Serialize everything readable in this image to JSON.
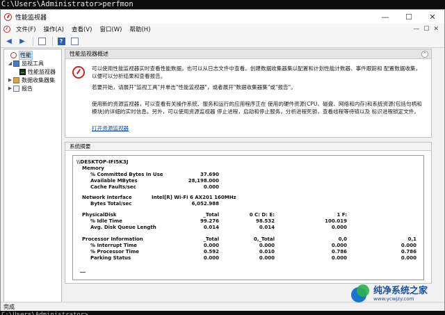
{
  "console": {
    "prompt_line": "C:\\Users\\Administrator>perfmon",
    "bottom_line": "C:\\Users\\Administrator>"
  },
  "window": {
    "title": "性能监视器",
    "controls": {
      "minimize": "—",
      "maximize": "☐",
      "close": "✕"
    }
  },
  "menubar": {
    "items": [
      "文件(F)",
      "操作(A)",
      "查看(V)",
      "窗口(W)",
      "帮助(H)"
    ],
    "right_controls": [
      "—",
      "☐",
      "✕"
    ]
  },
  "tree": {
    "root": "性能",
    "monitor_tools": "监视工具",
    "perf_monitor": "性能监视器",
    "collector_sets": "数据收集器集",
    "reports": "报告"
  },
  "overview": {
    "header": "性能监视器概述",
    "para1": "可以使用性能监视器实时查看性能数据，也可以从日志文件中查看。创建数据收集器集以配置和计划性能计数器、事件跟踪和 配置数据收集，以便可以分析结果和查看报告。",
    "para2": "若要开始，请展开\"监视工具\"并单击\"性能监视器\"，或者展开\"数据收集器集\"或\"报告\"。",
    "para3": "使用新的资源监视器，可以查看有关操作系统、服务和运行的应用程序正在 使用的硬件资源(CPU、磁盘、网络和内存)和系统资源(包括句柄和模块)的详细的实时信息。另外，可以使用资源监视器 停止进程，启动和停止服务，分析进程死锁，查看线程等待链以及 标识进程锁定文件。",
    "link": "打开资源监视器"
  },
  "summary": {
    "header": "系统摘要",
    "host": "\\\\DESKTOP-IFI5K3J",
    "memory": {
      "label": "Memory",
      "committed_label": "% Committed Bytes In Use",
      "committed": "37.690",
      "available_label": "Available MBytes",
      "available": "28,198.000",
      "cache_label": "Cache Faults/sec",
      "cache": "0.000"
    },
    "network": {
      "label": "Network Interface",
      "adapter": "Intel[R] Wi-Fi 6 AX201 160MHz",
      "bytes_label": "Bytes Total/sec",
      "bytes": "6,052.988"
    },
    "disk": {
      "label": "PhysicalDisk",
      "cols": [
        "_Total",
        "0 C: D: E:",
        "1 F:"
      ],
      "idle_label": "% Idle Time",
      "idle": [
        "99.276",
        "98.532",
        "100.019"
      ],
      "queue_label": "Avg. Disk Queue Length",
      "queue": [
        "0.014",
        "0.014",
        "0.000"
      ]
    },
    "processor": {
      "label": "Processor Information",
      "cols": [
        "_Total",
        "0,_Total",
        "0,0",
        "0,1"
      ],
      "interrupt_label": "% Interrupt Time",
      "interrupt": [
        "0.000",
        "0.000",
        "0.000",
        "0.000"
      ],
      "proc_label": "% Processor Time",
      "proc": [
        "0.592",
        "0.010",
        "0.786",
        "0.786"
      ],
      "parking_label": "Parking Status",
      "parking": [
        "0.000",
        "0.000",
        "0.000",
        "0.000"
      ]
    },
    "footer_dash": "—"
  },
  "statusbar": {
    "text": "完成"
  },
  "watermark": {
    "main": "纯净系统之家",
    "sub": "www.ycwjzy.com"
  },
  "icons": [
    "app-perfmon-icon",
    "back-arrow-icon",
    "forward-arrow-icon",
    "console-tree-icon",
    "properties-icon",
    "help-icon",
    "console-pane-icon"
  ]
}
